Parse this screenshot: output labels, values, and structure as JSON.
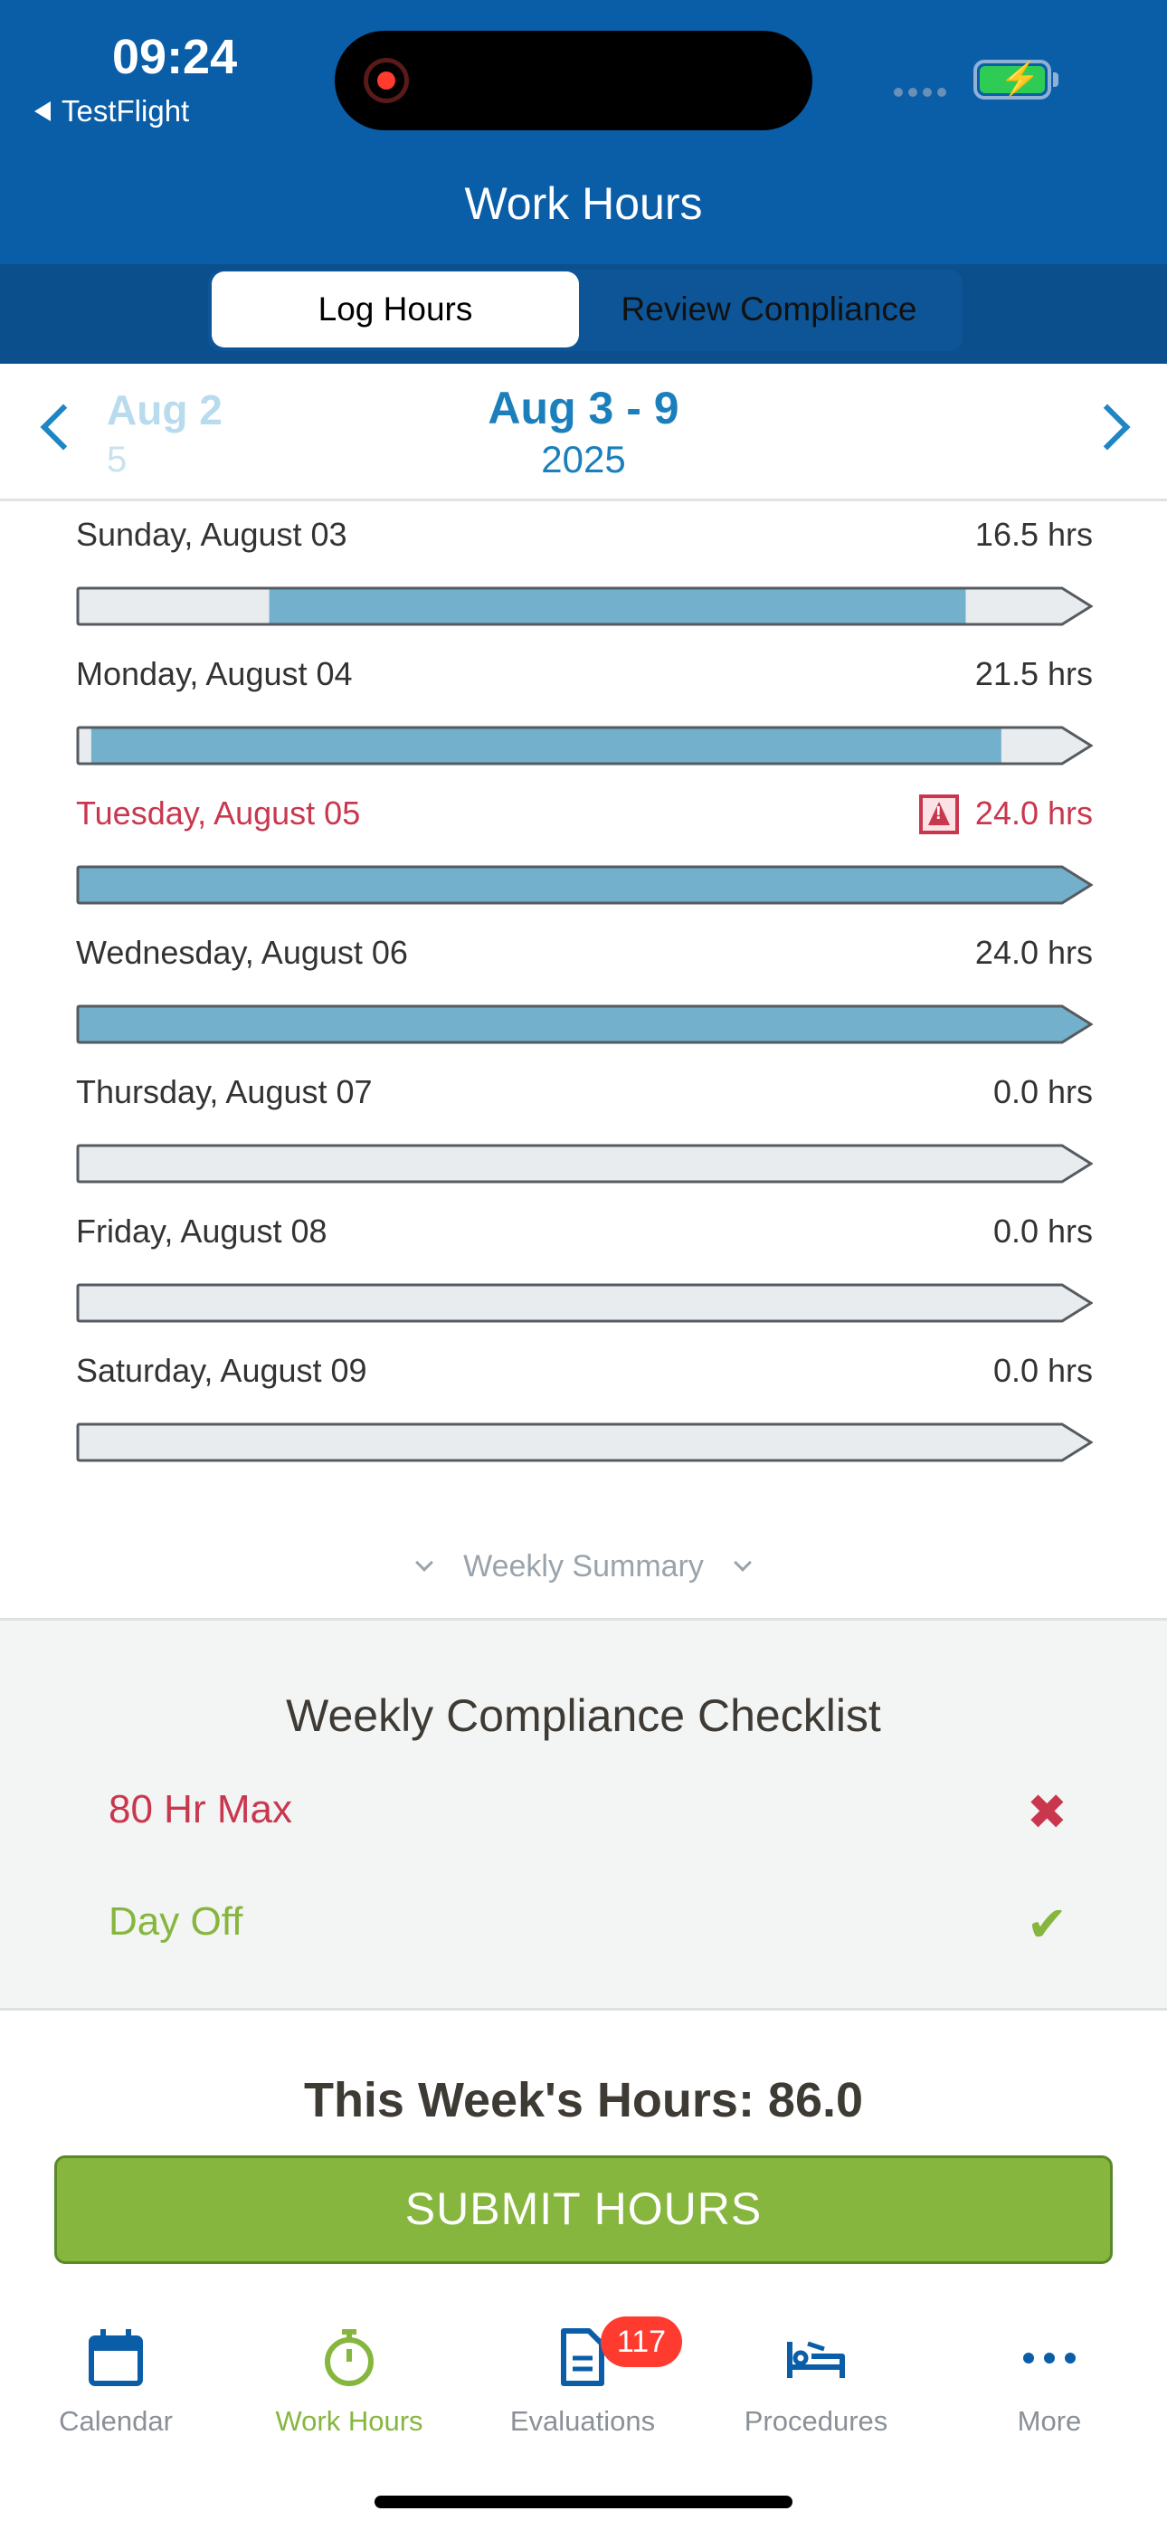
{
  "status": {
    "time": "09:24",
    "back_app": "TestFlight"
  },
  "header": {
    "title": "Work Hours"
  },
  "segments": {
    "active": "Log Hours",
    "inactive": "Review Compliance"
  },
  "week_nav": {
    "prev_week": "Aug 2",
    "prev_sub": "5",
    "current": "Aug 3 - 9",
    "year": "2025"
  },
  "days": [
    {
      "label": "Sunday, August 03",
      "hours": "16.5 hrs",
      "start": 0.19,
      "end": 0.875,
      "warning": false
    },
    {
      "label": "Monday, August 04",
      "hours": "21.5 hrs",
      "start": 0.015,
      "end": 0.91,
      "warning": false
    },
    {
      "label": "Tuesday, August 05",
      "hours": "24.0 hrs",
      "start": 0.0,
      "end": 1.0,
      "warning": true
    },
    {
      "label": "Wednesday, August 06",
      "hours": "24.0 hrs",
      "start": 0.0,
      "end": 1.0,
      "warning": false
    },
    {
      "label": "Thursday, August 07",
      "hours": "0.0 hrs",
      "start": 0,
      "end": 0,
      "warning": false
    },
    {
      "label": "Friday, August 08",
      "hours": "0.0 hrs",
      "start": 0,
      "end": 0,
      "warning": false
    },
    {
      "label": "Saturday, August 09",
      "hours": "0.0 hrs",
      "start": 0,
      "end": 0,
      "warning": false
    }
  ],
  "summary_toggle": "Weekly Summary",
  "checklist": {
    "title": "Weekly Compliance Checklist",
    "items": [
      {
        "label": "80 Hr Max",
        "status": "fail",
        "mark": "✖"
      },
      {
        "label": "Day Off",
        "status": "pass",
        "mark": "✔"
      }
    ]
  },
  "total": "This Week's Hours: 86.0",
  "submit_label": "SUBMIT HOURS",
  "tabs": [
    {
      "label": "Calendar",
      "icon": "calendar-icon"
    },
    {
      "label": "Work Hours",
      "icon": "stopwatch-icon",
      "active": true
    },
    {
      "label": "Evaluations",
      "icon": "document-icon",
      "badge": "117"
    },
    {
      "label": "Procedures",
      "icon": "bed-icon"
    },
    {
      "label": "More",
      "icon": "more-icon"
    }
  ],
  "colors": {
    "header": "#0a5ea8",
    "accent": "#1b7fbb",
    "bar_fill": "#73b0cc",
    "bar_bg": "#e8ecef",
    "warn": "#c9374f",
    "ok": "#86b63e"
  }
}
